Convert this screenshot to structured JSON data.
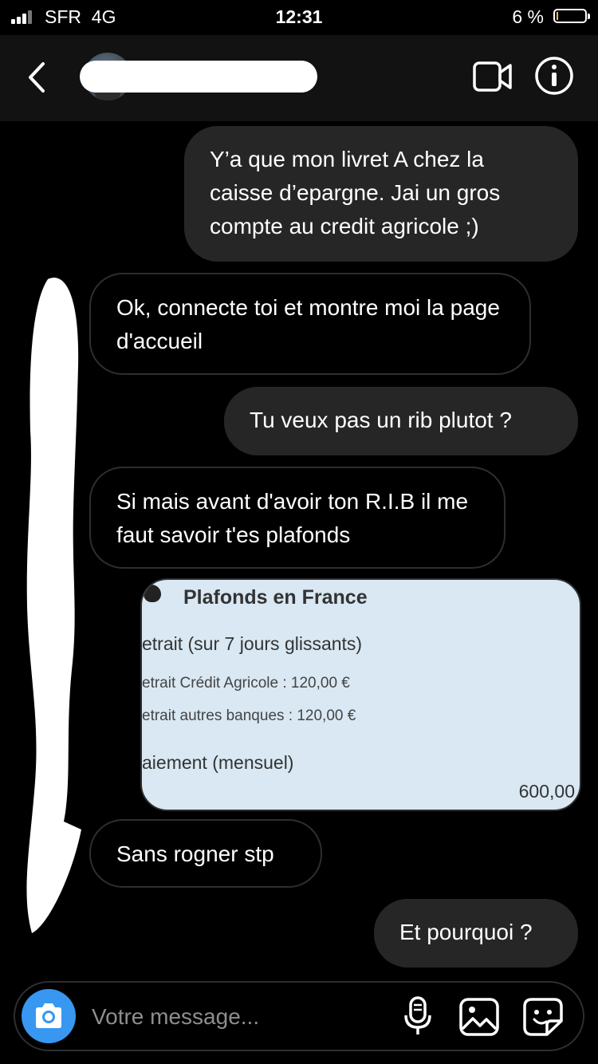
{
  "status_bar": {
    "carrier": "SFR",
    "network": "4G",
    "time": "12:31",
    "battery_percent": "6 %",
    "battery_level": 0.06,
    "battery_color": "#e6c24a"
  },
  "header": {
    "username": "",
    "back_icon": "chevron-left-icon",
    "video_icon": "video-camera-icon",
    "info_icon": "info-icon"
  },
  "messages": [
    {
      "direction": "out",
      "text": "Y’a que mon livret A chez la caisse d’epargne. Jai un gros compte au credit agricole ;)"
    },
    {
      "direction": "in",
      "text": "Ok, connecte toi et montre moi la page d'accueil"
    },
    {
      "direction": "out",
      "text": "Tu veux pas un rib plutot ?"
    },
    {
      "direction": "in",
      "text": "Si mais avant d'avoir ton R.I.B il me faut savoir t'es plafonds"
    },
    {
      "direction": "out",
      "type": "image",
      "image_text": {
        "title": "Plafonds en France",
        "line1": "etrait (sur 7 jours glissants)",
        "line2": "etrait Crédit Agricole : 120,00 €",
        "line3": "etrait autres banques : 120,00 €",
        "line4": "aiement (mensuel)",
        "line5": "600,00"
      }
    },
    {
      "direction": "in",
      "text": "Sans rogner stp"
    },
    {
      "direction": "out",
      "text": "Et pourquoi ?"
    }
  ],
  "composer": {
    "placeholder": "Votre message...",
    "camera_icon": "camera-icon",
    "mic_icon": "microphone-icon",
    "gallery_icon": "image-icon",
    "sticker_icon": "sticker-icon",
    "camera_color": "#3897f0"
  },
  "colors": {
    "background": "#000000",
    "header_bg": "#121212",
    "outgoing_bubble": "#262626",
    "incoming_border": "#2e2e2e"
  }
}
